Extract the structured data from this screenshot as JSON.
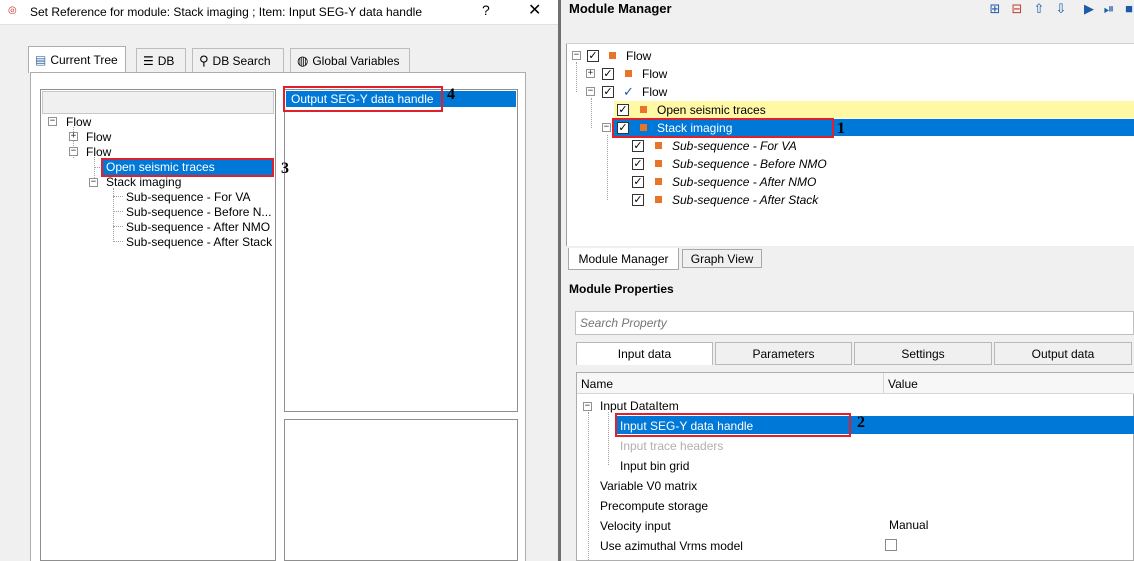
{
  "dialog": {
    "title": "Set Reference for module: Stack imaging ; Item: Input SEG-Y data handle",
    "help": "?",
    "close": "✕",
    "tabs": [
      {
        "label": "Current Tree",
        "icon": "tree-icon"
      },
      {
        "label": "DB",
        "icon": "database-icon"
      },
      {
        "label": "DB Search",
        "icon": "search-icon"
      },
      {
        "label": "Global Variables",
        "icon": "globe-icon"
      }
    ],
    "tree": {
      "root": "Flow",
      "child1": "Flow",
      "child2": "Flow",
      "open_seismic": "Open seismic traces",
      "stack_imaging": "Stack imaging",
      "sub_for_va": "Sub-sequence - For VA",
      "sub_before_nmo": "Sub-sequence - Before N...",
      "sub_after_nmo": "Sub-sequence - After NMO",
      "sub_after_stack": "Sub-sequence - After Stack"
    },
    "output_list": [
      "Output SEG-Y data handle"
    ]
  },
  "module_manager": {
    "title": "Module Manager",
    "tree": [
      {
        "label": "Flow",
        "checked": true
      },
      {
        "label": "Flow",
        "checked": true
      },
      {
        "label": "Flow",
        "checked": true
      },
      {
        "label": "Open seismic traces",
        "checked": true
      },
      {
        "label": "Stack imaging",
        "checked": true
      },
      {
        "label": "Sub-sequence - For VA",
        "checked": true
      },
      {
        "label": "Sub-sequence - Before NMO",
        "checked": true
      },
      {
        "label": "Sub-sequence - After NMO",
        "checked": true
      },
      {
        "label": "Sub-sequence - After Stack",
        "checked": true
      }
    ],
    "bottom_tabs": [
      "Module Manager",
      "Graph View"
    ]
  },
  "module_properties": {
    "title": "Module Properties",
    "search_placeholder": "Search Property",
    "tabs": [
      "Input data",
      "Parameters",
      "Settings",
      "Output data"
    ],
    "columns": [
      "Name",
      "Value"
    ],
    "rows": {
      "input_dataitem": "Input DataItem",
      "input_segy": "Input SEG-Y data handle",
      "input_trace_headers": "Input trace headers",
      "input_bin_grid": "Input bin grid",
      "variable_v0": "Variable V0 matrix",
      "precompute": "Precompute storage",
      "velocity_input": "Velocity input",
      "velocity_input_value": "Manual",
      "azimuthal": "Use azimuthal Vrms model"
    }
  },
  "callouts": [
    "1",
    "2",
    "3",
    "4"
  ],
  "colors": {
    "selection": "#0078d7",
    "highlight": "#fff9a6",
    "callout": "#e0202c",
    "node": "#e8742a"
  }
}
